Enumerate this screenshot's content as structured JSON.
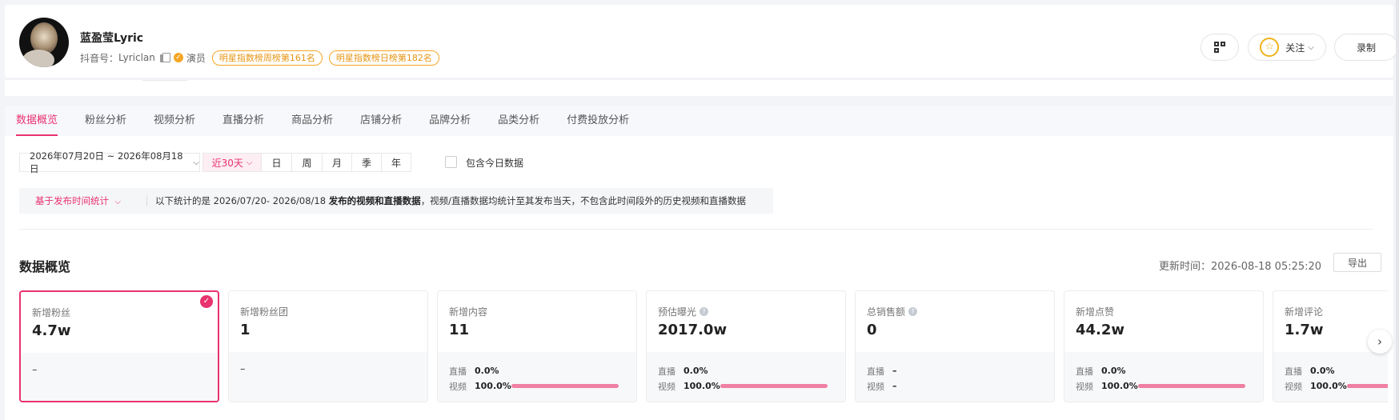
{
  "profile": {
    "name": "蓝盈莹Lyric",
    "douyin_label": "抖音号：",
    "douyin_id": "Lyriclan",
    "role": "演员",
    "weekly_rank": "明星指数榜周榜第161名",
    "daily_rank": "明星指数榜日榜第182名"
  },
  "header_actions": {
    "follow_label": "关注",
    "record_label": "录制"
  },
  "tabs": [
    "数据概览",
    "粉丝分析",
    "视频分析",
    "直播分析",
    "商品分析",
    "店铺分析",
    "品牌分析",
    "品类分析",
    "付费投放分析"
  ],
  "filters": {
    "date_range": "2026年07月20日 ~ 2026年08月18日",
    "periods": [
      "近30天",
      "日",
      "周",
      "月",
      "季",
      "年"
    ],
    "include_today_label": "包含今日数据"
  },
  "stat_note": {
    "basis": "基于发布时间统计",
    "prefix": "以下统计的是 2026/07/20- 2026/08/18 ",
    "bold": "发布的视频和直播数据",
    "suffix": "，视频/直播数据均统计至其发布当天，不包含此时间段外的历史视频和直播数据"
  },
  "overview": {
    "title": "数据概览",
    "update_time": "更新时间：2026-08-18 05:25:20",
    "export_label": "导出"
  },
  "cards": [
    {
      "label": "新增粉丝",
      "value": "4.7w",
      "dash": "–"
    },
    {
      "label": "新增粉丝团",
      "value": "1",
      "dash": "–"
    },
    {
      "label": "新增内容",
      "value": "11",
      "live_label": "直播",
      "live_pct": "0.0%",
      "video_label": "视频",
      "video_pct": "100.0%",
      "video_share": 1.0
    },
    {
      "label": "预估曝光",
      "value": "2017.0w",
      "live_label": "直播",
      "live_pct": "0.0%",
      "video_label": "视频",
      "video_pct": "100.0%",
      "video_share": 1.0
    },
    {
      "label": "总销售额",
      "value": "0",
      "live_label": "直播",
      "live_pct": "–",
      "video_label": "视频",
      "video_pct": "–"
    },
    {
      "label": "新增点赞",
      "value": "44.2w",
      "live_label": "直播",
      "live_pct": "0.0%",
      "video_label": "视频",
      "video_pct": "100.0%",
      "video_share": 1.0
    },
    {
      "label": "新增评论",
      "value": "1.7w",
      "live_label": "直播",
      "live_pct": "0.0%",
      "video_label": "视频",
      "video_pct": "100.0%",
      "video_share": 1.0
    }
  ],
  "colors": {
    "accent": "#e8336f",
    "badge": "#f5a623",
    "bar": "#f07fa2"
  }
}
